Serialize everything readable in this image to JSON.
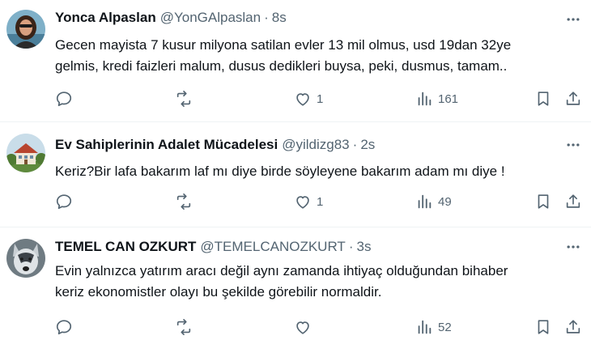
{
  "tweets": [
    {
      "name": "Yonca Alpaslan",
      "handle": "@YonGAlpaslan",
      "separator": "·",
      "time": "8s",
      "lines": [
        "Gecen mayista 7 kusur milyona satilan evler 13 mil olmus, usd 19dan 32ye",
        "gelmis, kredi faizleri malum, dusus dedikleri buysa, peki, dusmus, tamam.."
      ],
      "replies": "",
      "reposts": "",
      "likes": "1",
      "views": "161",
      "avatar_icon": "woman-portrait-icon"
    },
    {
      "name": "Ev Sahiplerinin Adalet Mücadelesi",
      "handle": "@yildizg83",
      "separator": "·",
      "time": "2s",
      "lines": [
        "Keriz?Bir lafa bakarım laf mı diye birde söyleyene bakarım adam mı diye !"
      ],
      "replies": "",
      "reposts": "",
      "likes": "1",
      "views": "49",
      "avatar_icon": "house-photo-icon"
    },
    {
      "name": "TEMEL CAN OZKURT",
      "handle": "@TEMELCANOZKURT",
      "separator": "·",
      "time": "3s",
      "lines": [
        "Evin yalnızca yatırım aracı değil aynı zamanda ihtiyaç olduğundan bihaber",
        "keriz ekonomistler olayı bu şekilde görebilir normaldir."
      ],
      "replies": "",
      "reposts": "",
      "likes": "",
      "views": "52",
      "avatar_icon": "wolf-photo-icon"
    }
  ],
  "colors": {
    "text": "#0f1419",
    "secondary": "#536471",
    "divider": "#eff3f4"
  }
}
